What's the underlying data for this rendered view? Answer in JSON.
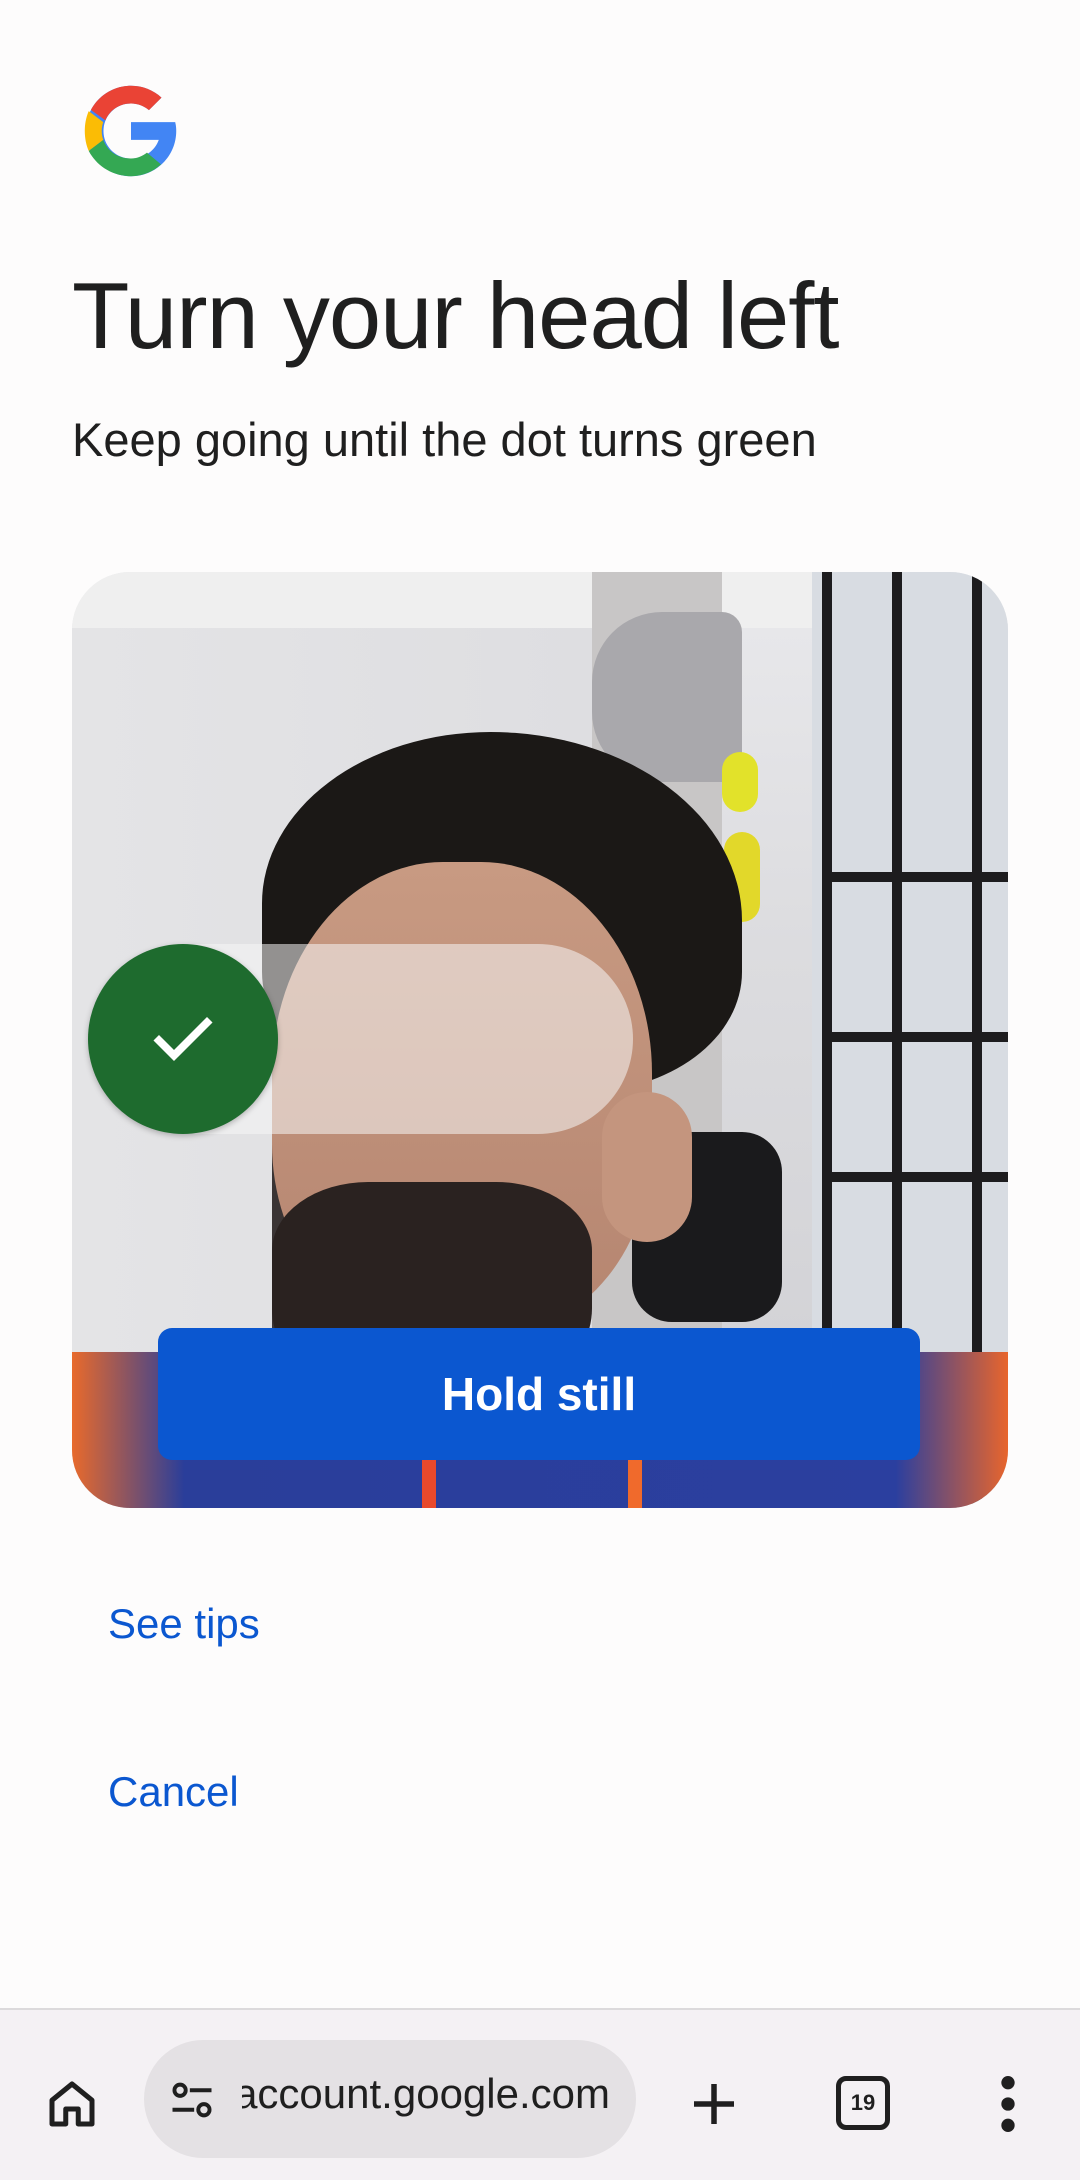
{
  "header": {
    "logo_icon": "google-g-logo",
    "title": "Turn your head left",
    "subtitle": "Keep going until the dot turns green"
  },
  "camera": {
    "progress_icon": "checkmark-icon",
    "progress_color": "#1e6b2e",
    "status_button_label": "Hold still",
    "status_button_color": "#0b57d0"
  },
  "links": {
    "see_tips": "See tips",
    "cancel": "Cancel"
  },
  "browser_toolbar": {
    "home_icon": "home-icon",
    "site_info_icon": "site-settings-icon",
    "url": "account.google.com",
    "new_tab_icon": "plus-icon",
    "tab_count": "19",
    "menu_icon": "more-vertical-icon"
  },
  "colors": {
    "accent": "#0b57d0",
    "success": "#1e6b2e"
  }
}
